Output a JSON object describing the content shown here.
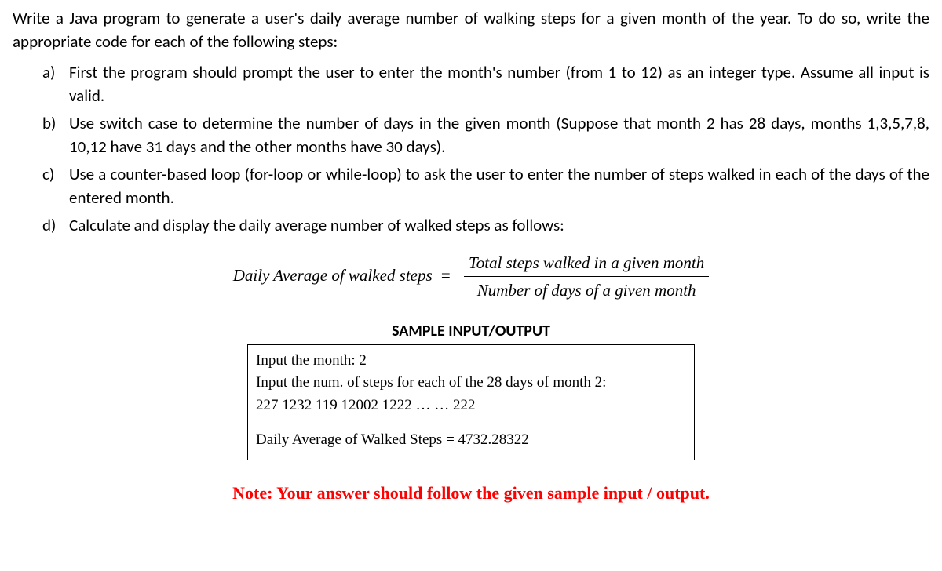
{
  "intro": "Write a Java program to generate a user's daily average number of walking steps for a given month of the year. To do so, write the appropriate code for each of the following steps:",
  "items": [
    {
      "marker": "a)",
      "text": "First the program should prompt the user to enter the month's number (from 1 to 12) as an integer type. Assume all input is valid."
    },
    {
      "marker": "b)",
      "text": "Use switch case to determine the number of days in the given month (Suppose that month 2 has 28 days, months 1,3,5,7,8, 10,12 have 31 days and the other months have 30 days)."
    },
    {
      "marker": "c)",
      "text": "Use a counter-based loop (for-loop or while-loop) to ask the user to enter the number of steps walked in each of the days of the entered month."
    },
    {
      "marker": "d)",
      "text": "Calculate and display the daily average number of walked steps as follows:"
    }
  ],
  "formula": {
    "left": "Daily Average of walked steps",
    "eq": "=",
    "num": "Total steps walked in a given month",
    "den": "Number of days of a given month"
  },
  "sample": {
    "title": "SAMPLE INPUT/OUTPUT",
    "line1": "Input the month: 2",
    "line2": "Input the num. of steps for each of the 28 days of month 2:",
    "line3": "227 1232 119 12002 1222 … … 222",
    "line4": "Daily Average of Walked Steps = 4732.28322"
  },
  "note": "Note: Your answer should follow the given sample input / output."
}
